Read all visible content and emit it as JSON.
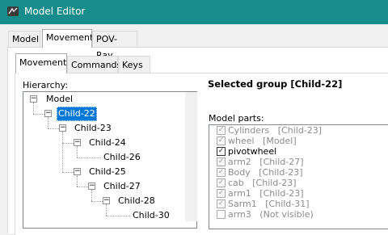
{
  "window": {
    "title": "Model Editor"
  },
  "outer_tabs": [
    {
      "label": "Model"
    },
    {
      "label": "Movement"
    },
    {
      "label": "POV-Ray"
    }
  ],
  "inner_tabs": [
    {
      "label": "Movement"
    },
    {
      "label": "Commands"
    },
    {
      "label": "Keys"
    }
  ],
  "hierarchy": {
    "label": "Hierarchy:",
    "nodes": [
      {
        "label": "Model"
      },
      {
        "label": "Child-22"
      },
      {
        "label": "Child-23"
      },
      {
        "label": "Child-24"
      },
      {
        "label": "Child-26"
      },
      {
        "label": "Child-25"
      },
      {
        "label": "Child-27"
      },
      {
        "label": "Child-28"
      },
      {
        "label": "Child-30"
      }
    ]
  },
  "selected_group": {
    "title": "Selected group [Child-22]"
  },
  "model_parts": {
    "label": "Model parts:",
    "items": [
      {
        "label": "Cylinders   [Child-23]",
        "checked": true,
        "enabled": false
      },
      {
        "label": "wheel   [Model]",
        "checked": true,
        "enabled": false
      },
      {
        "label": "pivotwheel",
        "checked": true,
        "enabled": true
      },
      {
        "label": "arm2   [Child-27]",
        "checked": true,
        "enabled": false
      },
      {
        "label": "Body   [Child-23]",
        "checked": true,
        "enabled": false
      },
      {
        "label": "cab   [Child-23]",
        "checked": true,
        "enabled": false
      },
      {
        "label": "arm1   [Child-23]",
        "checked": true,
        "enabled": false
      },
      {
        "label": "Sarm1   [Child-31]",
        "checked": true,
        "enabled": false
      },
      {
        "label": "arm3   (Not visible)",
        "checked": false,
        "enabled": false
      }
    ]
  }
}
